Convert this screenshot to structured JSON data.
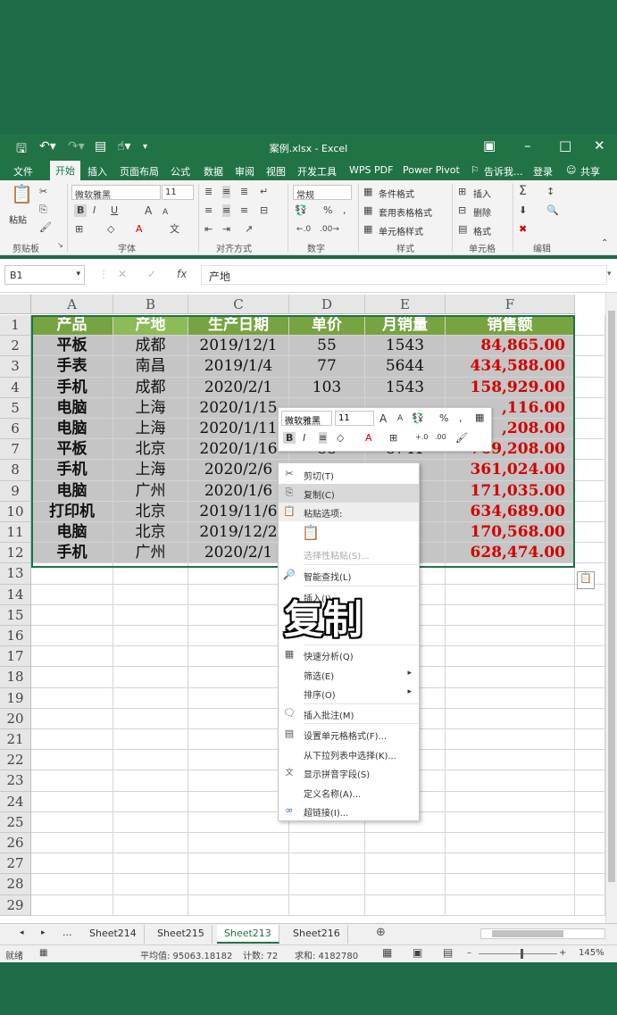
{
  "window": {
    "title": "案例.xlsx - Excel",
    "quick_access": [
      "save-icon",
      "undo-icon",
      "redo-icon",
      "form-icon",
      "touch-icon",
      "customize-icon"
    ],
    "controls": [
      "ribbon-display-icon",
      "minimize-icon",
      "maximize-icon",
      "close-icon"
    ]
  },
  "tabs": [
    "文件",
    "开始",
    "插入",
    "页面布局",
    "公式",
    "数据",
    "审阅",
    "视图",
    "开发工具",
    "WPS PDF",
    "Power Pivot"
  ],
  "active_tab": "开始",
  "tell_me": "告诉我...",
  "login": "登录",
  "share": "共享",
  "ribbon": {
    "clipboard": {
      "paste": "粘贴",
      "label": "剪贴板"
    },
    "font": {
      "name": "微软雅黑",
      "size": "11",
      "bold": "B",
      "italic": "I",
      "underline": "U",
      "grow": "A",
      "shrink": "A",
      "label": "字体"
    },
    "alignment": {
      "label": "对齐方式"
    },
    "number": {
      "format": "常规",
      "percent": "%",
      "comma": ",",
      "label": "数字"
    },
    "styles": {
      "conditional": "条件格式",
      "table": "套用表格格式",
      "cell": "单元格样式",
      "label": "样式"
    },
    "cells": {
      "insert": "插入",
      "delete": "删除",
      "format": "格式",
      "label": "单元格"
    },
    "editing": {
      "label": "编辑"
    }
  },
  "formula_bar": {
    "name_box": "B1",
    "content": "产地",
    "fx": "fx"
  },
  "columns": [
    "A",
    "B",
    "C",
    "D",
    "E",
    "F"
  ],
  "row_numbers": [
    "1",
    "2",
    "3",
    "4",
    "5",
    "6",
    "7",
    "8",
    "9",
    "10",
    "11",
    "12",
    "13",
    "14",
    "15",
    "16",
    "17",
    "18",
    "19",
    "20",
    "21",
    "22",
    "23",
    "24",
    "25",
    "26",
    "27",
    "28",
    "29"
  ],
  "table": {
    "headers": [
      "产品",
      "产地",
      "生产日期",
      "单价",
      "月销量",
      "销售额"
    ],
    "rows": [
      [
        "平板",
        "成都",
        "2019/12/1",
        "55",
        "1543",
        "84,865.00"
      ],
      [
        "手表",
        "南昌",
        "2019/1/4",
        "77",
        "5644",
        "434,588.00"
      ],
      [
        "手机",
        "成都",
        "2020/2/1",
        "103",
        "1543",
        "158,929.00"
      ],
      [
        "电脑",
        "上海",
        "2020/1/15",
        "",
        "",
        ",116.00"
      ],
      [
        "电脑",
        "上海",
        "2020/1/11",
        "",
        "",
        ",208.00"
      ],
      [
        "平板",
        "北京",
        "2020/1/16",
        "88",
        "8741",
        "769,208.00"
      ],
      [
        "手机",
        "上海",
        "2020/2/6",
        "",
        "",
        "361,024.00"
      ],
      [
        "电脑",
        "广州",
        "2020/1/6",
        "",
        "5",
        "171,035.00"
      ],
      [
        "打印机",
        "北京",
        "2019/11/6",
        "",
        "",
        "634,689.00"
      ],
      [
        "电脑",
        "北京",
        "2019/12/2",
        "",
        "1",
        "170,568.00"
      ],
      [
        "手机",
        "广州",
        "2020/2/1",
        "",
        "3",
        "628,474.00"
      ]
    ]
  },
  "mini_toolbar": {
    "font": "微软雅黑",
    "size": "11",
    "grow": "A",
    "shrink": "A",
    "percent": "%",
    "comma": ",",
    "bold": "B",
    "italic": "I"
  },
  "context_menu": {
    "items": [
      {
        "label": "剪切(T)",
        "icon": "cut-icon"
      },
      {
        "label": "复制(C)",
        "icon": "copy-icon"
      },
      {
        "label": "粘贴选项:",
        "icon": "paste-icon"
      },
      {
        "label": "选择性粘贴(S)...",
        "icon": ""
      },
      {
        "label": "智能查找(L)",
        "icon": "smart-lookup-icon"
      },
      {
        "label": "插入(I)...",
        "icon": ""
      },
      {
        "label": "快速分析(Q)",
        "icon": "quick-analysis-icon"
      },
      {
        "label": "筛选(E)",
        "icon": ""
      },
      {
        "label": "排序(O)",
        "icon": ""
      },
      {
        "label": "插入批注(M)",
        "icon": "comment-icon"
      },
      {
        "label": "设置单元格格式(F)...",
        "icon": "format-cells-icon"
      },
      {
        "label": "从下拉列表中选择(K)...",
        "icon": ""
      },
      {
        "label": "显示拼音字段(S)",
        "icon": "phonetic-icon"
      },
      {
        "label": "定义名称(A)...",
        "icon": ""
      },
      {
        "label": "超链接(I)...",
        "icon": "hyperlink-icon"
      }
    ]
  },
  "overlay_caption": "复制",
  "sheets": [
    "Sheet214",
    "Sheet215",
    "Sheet213",
    "Sheet216"
  ],
  "active_sheet": "Sheet213",
  "sheet_nav_more": "...",
  "status": {
    "mode": "就绪",
    "average": "平均值: 95063.18182",
    "count": "计数: 72",
    "sum": "求和: 4182780",
    "zoom": "145%"
  },
  "colors": {
    "excel_green": "#217346",
    "header_green": "#77a341",
    "money_red": "#d40000"
  }
}
